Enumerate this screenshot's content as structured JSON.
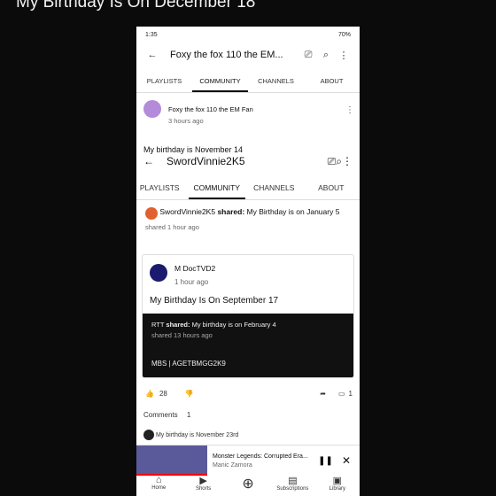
{
  "caption": "My Birthday Is On December 18",
  "status": {
    "time": "1:35",
    "battery": "70%"
  },
  "header": {
    "channel": "Foxy the fox 110 the EM..."
  },
  "tabs": [
    "PLAYLISTS",
    "COMMUNITY",
    "CHANNELS",
    "ABOUT"
  ],
  "post": {
    "author": "Foxy the fox 110 the EM Fan",
    "time": "3 hours ago",
    "text": "My birthday is November 14"
  },
  "inner": {
    "channel": "SwordVinnie2K5",
    "tabs": [
      "PLAYLISTS",
      "COMMUNITY",
      "CHANNELS",
      "ABOUT"
    ],
    "shared_author": "SwordVinnie2K5",
    "shared_label": "shared:",
    "shared_text": "My Birthday is on January 5",
    "shared_time": "shared 1 hour ago"
  },
  "card": {
    "author": "M DocTVD2",
    "time": "1 hour ago",
    "text": "My Birthday Is On September 17",
    "dark1_author": "RTT",
    "dark1_label": "shared:",
    "dark1_text": "My birthday is on February 4",
    "dark1_time": "shared 13 hours ago",
    "dark2_author": "MBS | AGETBMGG2K9"
  },
  "actions": {
    "likes": "28",
    "shares": "1"
  },
  "comments": {
    "label": "Comments",
    "count": "1",
    "top": "My birthday is November 23rd"
  },
  "mini": {
    "title": "Monster Legends: Corrupted Era...",
    "artist": "Manic Zamora"
  },
  "nav": [
    "Home",
    "Shorts",
    "Subscriptions",
    "Library"
  ]
}
